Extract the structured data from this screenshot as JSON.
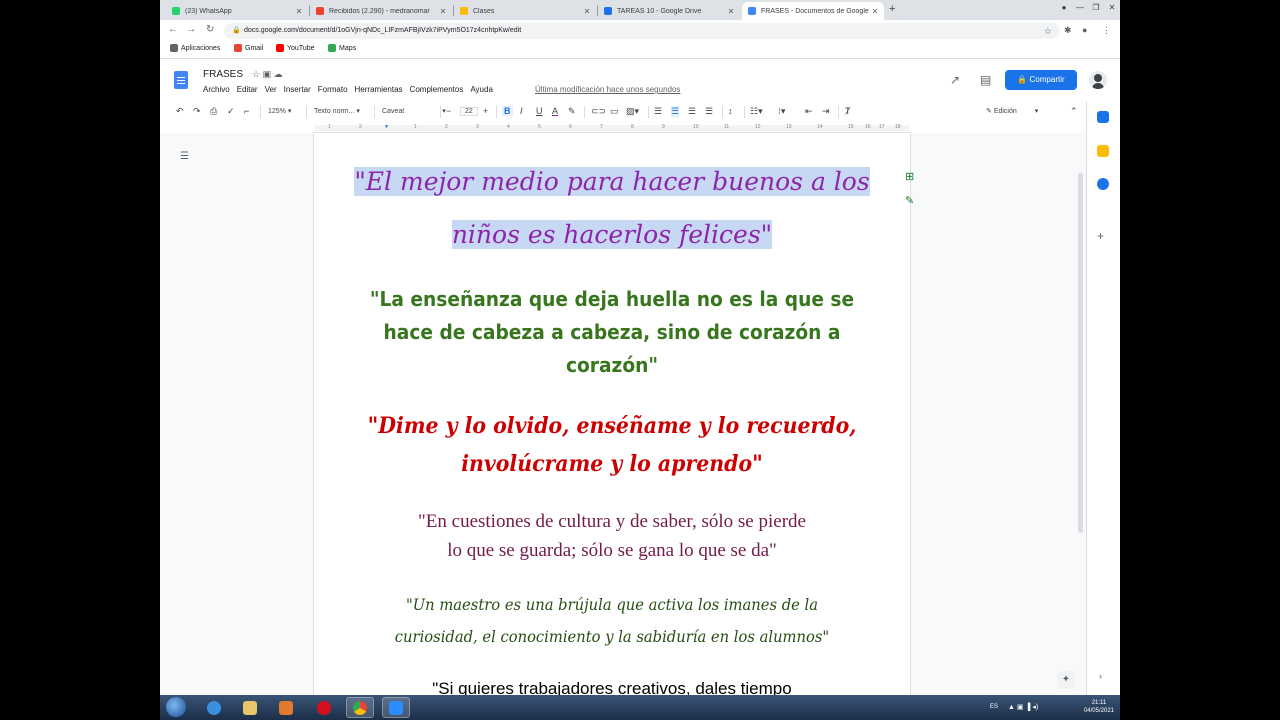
{
  "browser": {
    "tabs": [
      {
        "label": "(23) WhatsApp",
        "color": "#25d366",
        "active": false
      },
      {
        "label": "Recibidos (2.290) - medranomar",
        "color": "#ea4335",
        "active": false
      },
      {
        "label": "Clases",
        "color": "#fbbc04",
        "active": false
      },
      {
        "label": "TAREAS 10 - Google Drive",
        "color": "#1a73e8",
        "active": false
      },
      {
        "label": "FRASES - Documentos de Google",
        "color": "#4285f4",
        "active": true
      }
    ],
    "close_glyph": "✕",
    "new_tab_glyph": "+",
    "url": "docs.google.com/document/d/1oGVjn-qNDc_LIFzmAFBjIVzk7iPVym5O17z4cnhtpKw/edit",
    "bookmarks": [
      {
        "label": "Aplicaciones",
        "color": "#5f6368"
      },
      {
        "label": "Gmail",
        "color": "#ea4335"
      },
      {
        "label": "YouTube",
        "color": "#ff0000"
      },
      {
        "label": "Maps",
        "color": "#34a853"
      }
    ]
  },
  "docs": {
    "title": "FRASES",
    "menus": [
      "Archivo",
      "Editar",
      "Ver",
      "Insertar",
      "Formato",
      "Herramientas",
      "Complementos",
      "Ayuda"
    ],
    "last_modified": "Última modificación hace unos segundos",
    "share_label": "Compartir",
    "toolbar": {
      "zoom": "125%",
      "style": "Texto norm...",
      "font": "Caveat",
      "font_size": "22",
      "mode": "Edición"
    },
    "ruler_marks": [
      "1",
      "2",
      "1",
      "2",
      "3",
      "4",
      "5",
      "6",
      "7",
      "8",
      "9",
      "10",
      "11",
      "12",
      "13",
      "14",
      "15",
      "16",
      "17",
      "18"
    ]
  },
  "document": {
    "quote1_line1": "\"El mejor medio para hacer buenos a los",
    "quote1_line2": "niños es hacerlos felices\"",
    "quote2_line1": "\"La enseñanza que deja huella no es la que se",
    "quote2_line2": "hace de cabeza a cabeza, sino de corazón a",
    "quote2_line3": "corazón\"",
    "quote3_line1": "\"Dime y lo olvido, enséñame y lo recuerdo,",
    "quote3_line2": "involúcrame y lo aprendo\"",
    "quote4_line1": "\"En cuestiones de cultura y de saber, sólo se pierde",
    "quote4_line2": "lo que se guarda; sólo se gana lo que se da\"",
    "quote5_line1": "\"Un maestro es una brújula que activa los imanes de la",
    "quote5_line2": "curiosidad, el conocimiento y la sabiduría en los alumnos\"",
    "quote6_line1": "\"Si quieres trabajadores creativos, dales tiempo"
  },
  "taskbar": {
    "lang": "ES",
    "time": "21:11",
    "date": "04/05/2021"
  }
}
